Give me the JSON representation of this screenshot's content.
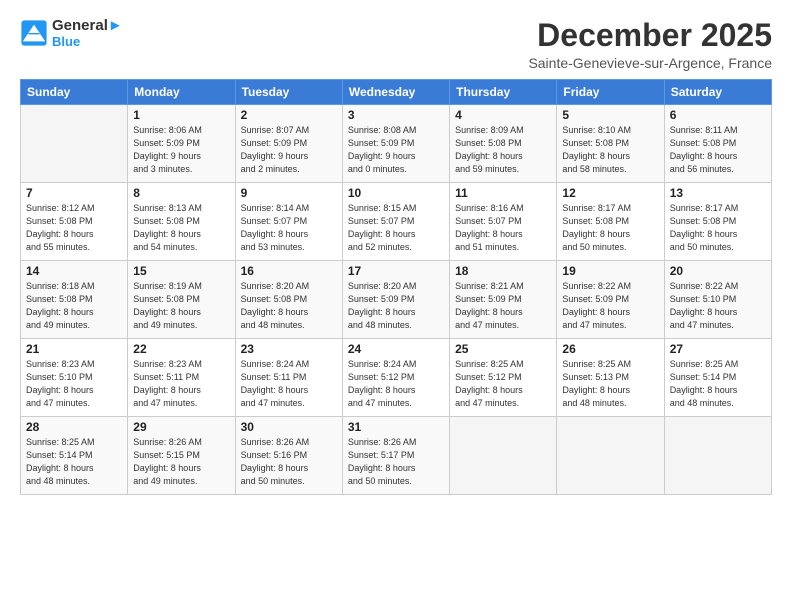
{
  "header": {
    "logo_line1": "General",
    "logo_line2": "Blue",
    "title": "December 2025",
    "subtitle": "Sainte-Genevieve-sur-Argence, France"
  },
  "weekdays": [
    "Sunday",
    "Monday",
    "Tuesday",
    "Wednesday",
    "Thursday",
    "Friday",
    "Saturday"
  ],
  "weeks": [
    [
      {
        "day": "",
        "info": ""
      },
      {
        "day": "1",
        "info": "Sunrise: 8:06 AM\nSunset: 5:09 PM\nDaylight: 9 hours\nand 3 minutes."
      },
      {
        "day": "2",
        "info": "Sunrise: 8:07 AM\nSunset: 5:09 PM\nDaylight: 9 hours\nand 2 minutes."
      },
      {
        "day": "3",
        "info": "Sunrise: 8:08 AM\nSunset: 5:09 PM\nDaylight: 9 hours\nand 0 minutes."
      },
      {
        "day": "4",
        "info": "Sunrise: 8:09 AM\nSunset: 5:08 PM\nDaylight: 8 hours\nand 59 minutes."
      },
      {
        "day": "5",
        "info": "Sunrise: 8:10 AM\nSunset: 5:08 PM\nDaylight: 8 hours\nand 58 minutes."
      },
      {
        "day": "6",
        "info": "Sunrise: 8:11 AM\nSunset: 5:08 PM\nDaylight: 8 hours\nand 56 minutes."
      }
    ],
    [
      {
        "day": "7",
        "info": "Sunrise: 8:12 AM\nSunset: 5:08 PM\nDaylight: 8 hours\nand 55 minutes."
      },
      {
        "day": "8",
        "info": "Sunrise: 8:13 AM\nSunset: 5:08 PM\nDaylight: 8 hours\nand 54 minutes."
      },
      {
        "day": "9",
        "info": "Sunrise: 8:14 AM\nSunset: 5:07 PM\nDaylight: 8 hours\nand 53 minutes."
      },
      {
        "day": "10",
        "info": "Sunrise: 8:15 AM\nSunset: 5:07 PM\nDaylight: 8 hours\nand 52 minutes."
      },
      {
        "day": "11",
        "info": "Sunrise: 8:16 AM\nSunset: 5:07 PM\nDaylight: 8 hours\nand 51 minutes."
      },
      {
        "day": "12",
        "info": "Sunrise: 8:17 AM\nSunset: 5:08 PM\nDaylight: 8 hours\nand 50 minutes."
      },
      {
        "day": "13",
        "info": "Sunrise: 8:17 AM\nSunset: 5:08 PM\nDaylight: 8 hours\nand 50 minutes."
      }
    ],
    [
      {
        "day": "14",
        "info": "Sunrise: 8:18 AM\nSunset: 5:08 PM\nDaylight: 8 hours\nand 49 minutes."
      },
      {
        "day": "15",
        "info": "Sunrise: 8:19 AM\nSunset: 5:08 PM\nDaylight: 8 hours\nand 49 minutes."
      },
      {
        "day": "16",
        "info": "Sunrise: 8:20 AM\nSunset: 5:08 PM\nDaylight: 8 hours\nand 48 minutes."
      },
      {
        "day": "17",
        "info": "Sunrise: 8:20 AM\nSunset: 5:09 PM\nDaylight: 8 hours\nand 48 minutes."
      },
      {
        "day": "18",
        "info": "Sunrise: 8:21 AM\nSunset: 5:09 PM\nDaylight: 8 hours\nand 47 minutes."
      },
      {
        "day": "19",
        "info": "Sunrise: 8:22 AM\nSunset: 5:09 PM\nDaylight: 8 hours\nand 47 minutes."
      },
      {
        "day": "20",
        "info": "Sunrise: 8:22 AM\nSunset: 5:10 PM\nDaylight: 8 hours\nand 47 minutes."
      }
    ],
    [
      {
        "day": "21",
        "info": "Sunrise: 8:23 AM\nSunset: 5:10 PM\nDaylight: 8 hours\nand 47 minutes."
      },
      {
        "day": "22",
        "info": "Sunrise: 8:23 AM\nSunset: 5:11 PM\nDaylight: 8 hours\nand 47 minutes."
      },
      {
        "day": "23",
        "info": "Sunrise: 8:24 AM\nSunset: 5:11 PM\nDaylight: 8 hours\nand 47 minutes."
      },
      {
        "day": "24",
        "info": "Sunrise: 8:24 AM\nSunset: 5:12 PM\nDaylight: 8 hours\nand 47 minutes."
      },
      {
        "day": "25",
        "info": "Sunrise: 8:25 AM\nSunset: 5:12 PM\nDaylight: 8 hours\nand 47 minutes."
      },
      {
        "day": "26",
        "info": "Sunrise: 8:25 AM\nSunset: 5:13 PM\nDaylight: 8 hours\nand 48 minutes."
      },
      {
        "day": "27",
        "info": "Sunrise: 8:25 AM\nSunset: 5:14 PM\nDaylight: 8 hours\nand 48 minutes."
      }
    ],
    [
      {
        "day": "28",
        "info": "Sunrise: 8:25 AM\nSunset: 5:14 PM\nDaylight: 8 hours\nand 48 minutes."
      },
      {
        "day": "29",
        "info": "Sunrise: 8:26 AM\nSunset: 5:15 PM\nDaylight: 8 hours\nand 49 minutes."
      },
      {
        "day": "30",
        "info": "Sunrise: 8:26 AM\nSunset: 5:16 PM\nDaylight: 8 hours\nand 50 minutes."
      },
      {
        "day": "31",
        "info": "Sunrise: 8:26 AM\nSunset: 5:17 PM\nDaylight: 8 hours\nand 50 minutes."
      },
      {
        "day": "",
        "info": ""
      },
      {
        "day": "",
        "info": ""
      },
      {
        "day": "",
        "info": ""
      }
    ]
  ]
}
